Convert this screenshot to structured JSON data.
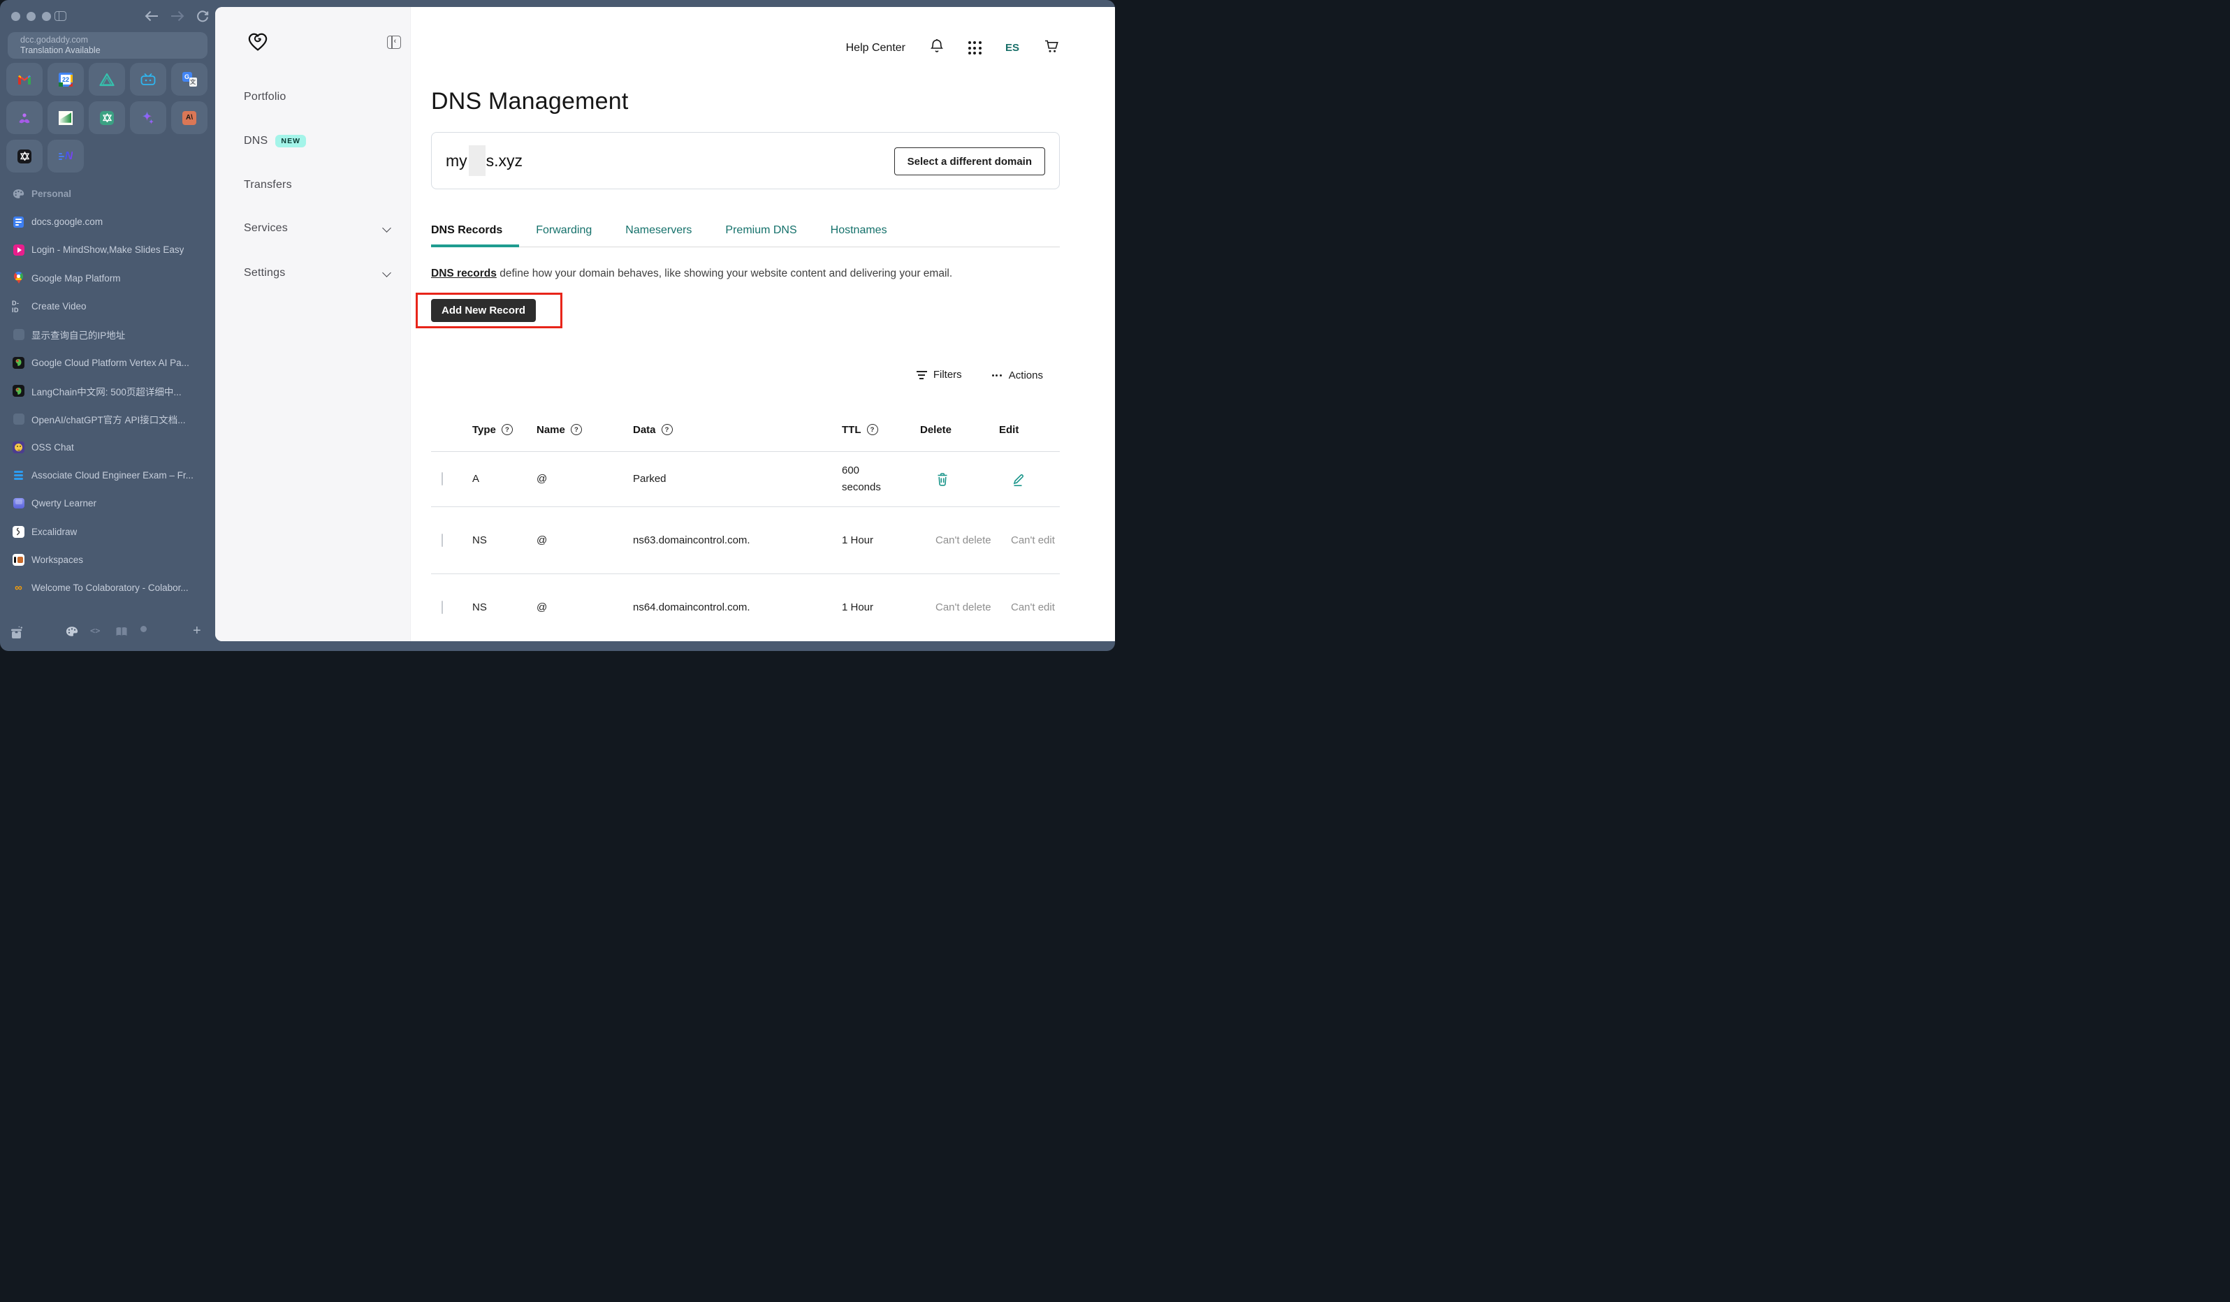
{
  "window": {
    "url_line1": "dcc.godaddy.com",
    "url_line2": "Translation Available"
  },
  "browser": {
    "app_grid": [
      {
        "icon": "gmail"
      },
      {
        "icon": "gcal"
      },
      {
        "icon": "triangle"
      },
      {
        "icon": "bilibili"
      },
      {
        "icon": "gtranslate"
      },
      {
        "icon": "mindshow"
      },
      {
        "icon": "greenchart"
      },
      {
        "icon": "chatgpt"
      },
      {
        "icon": "gemini"
      },
      {
        "icon": "anthropic"
      },
      {
        "icon": "openai"
      },
      {
        "icon": "nspeed"
      }
    ],
    "bookmarks": [
      {
        "icon": "palette",
        "label": "Personal",
        "section": true
      },
      {
        "icon": "gdocs",
        "label": "docs.google.com"
      },
      {
        "icon": "play",
        "label": "Login - MindShow,Make Slides Easy"
      },
      {
        "icon": "gmap",
        "label": "Google Map Platform"
      },
      {
        "icon": "did",
        "label": "Create Video"
      },
      {
        "icon": "placeholder",
        "label": "显示查询自己的IP地址"
      },
      {
        "icon": "parrot",
        "label": "Google Cloud Platform Vertex AI Pa..."
      },
      {
        "icon": "parrot",
        "label": "LangChain中文网: 500页超详细中..."
      },
      {
        "icon": "placeholder",
        "label": "OpenAI/chatGPT官方 API接口文档..."
      },
      {
        "icon": "oss",
        "label": "OSS Chat"
      },
      {
        "icon": "bars",
        "label": "Associate Cloud Engineer Exam – Fr..."
      },
      {
        "icon": "keycap",
        "label": "Qwerty Learner"
      },
      {
        "icon": "excalidraw",
        "label": "Excalidraw"
      },
      {
        "icon": "workspaces",
        "label": "Workspaces"
      },
      {
        "icon": "colab",
        "label": "Welcome To Colaboratory - Colabor..."
      }
    ]
  },
  "gd_sidebar": {
    "menu": [
      {
        "label": "Portfolio"
      },
      {
        "label": "DNS",
        "badge": "NEW"
      },
      {
        "label": "Transfers"
      },
      {
        "label": "Services",
        "chevron": true
      },
      {
        "label": "Settings",
        "chevron": true
      }
    ]
  },
  "header": {
    "help_center": "Help Center",
    "language": "ES"
  },
  "main": {
    "title": "DNS Management",
    "domain_prefix": "my",
    "domain_suffix": "s.xyz",
    "select_domain_button": "Select a different domain",
    "tabs": [
      {
        "label": "DNS Records",
        "active": true
      },
      {
        "label": "Forwarding"
      },
      {
        "label": "Nameservers"
      },
      {
        "label": "Premium DNS"
      },
      {
        "label": "Hostnames"
      }
    ],
    "description_link": "DNS records",
    "description_rest": " define how your domain behaves, like showing your website content and delivering your email.",
    "add_record_button": "Add New Record",
    "filters_label": "Filters",
    "actions_label": "Actions",
    "table": {
      "headers": [
        {
          "label": "Type",
          "help": true
        },
        {
          "label": "Name",
          "help": true
        },
        {
          "label": "Data",
          "help": true
        },
        {
          "label": "TTL",
          "help": true
        },
        {
          "label": "Delete",
          "help": false
        },
        {
          "label": "Edit",
          "help": false
        }
      ],
      "rows": [
        {
          "type": "A",
          "name": "@",
          "data": "Parked",
          "ttl": "600 seconds",
          "deletable": true,
          "editable": true,
          "delete_text": "",
          "edit_text": ""
        },
        {
          "type": "NS",
          "name": "@",
          "data": "ns63.domaincontrol.com.",
          "ttl": "1 Hour",
          "deletable": false,
          "editable": false,
          "delete_text": "Can't delete",
          "edit_text": "Can't edit"
        },
        {
          "type": "NS",
          "name": "@",
          "data": "ns64.domaincontrol.com.",
          "ttl": "1 Hour",
          "deletable": false,
          "editable": false,
          "delete_text": "Can't delete",
          "edit_text": "Can't edit"
        }
      ]
    }
  },
  "colors": {
    "slate_bg": "#4A5A70",
    "teal_link": "#15716B",
    "teal_bar": "#1F9C90",
    "teal_icon": "#1B968B",
    "badge_bg": "#A4F4E9",
    "red_annotation": "#E8251A",
    "dark_button": "#2D2D2D",
    "muted_text": "#8F8F8F"
  }
}
